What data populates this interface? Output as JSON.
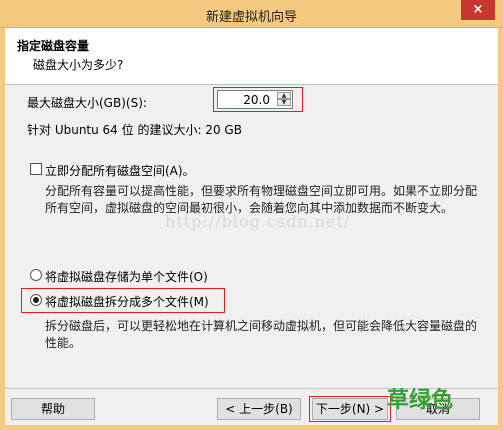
{
  "window": {
    "title": "新建虚拟机向导",
    "close": "×"
  },
  "header": {
    "title": "指定磁盘容量",
    "subtitle": "磁盘大小为多少?"
  },
  "disk": {
    "max_label": "最大磁盘大小(GB)(S):",
    "max_value": "20.0",
    "recommend": "针对 Ubuntu 64 位 的建议大小: 20 GB"
  },
  "allocate": {
    "label": "立即分配所有磁盘空间(A)。",
    "desc": "分配所有容量可以提高性能，但要求所有物理磁盘空间立即可用。如果不立即分配所有空间，虚拟磁盘的空间最初很小，会随着您向其中添加数据而不断变大。",
    "checked": false
  },
  "watermark": "http://blog.csdn.net/",
  "options": {
    "single": "将虚拟磁盘存储为单个文件(O)",
    "multiple": "将虚拟磁盘拆分成多个文件(M)",
    "selected": "multiple",
    "multiple_desc": "拆分磁盘后，可以更轻松地在计算机之间移动虚拟机，但可能会降低大容量磁盘的性能。"
  },
  "footer": {
    "help": "帮助",
    "back": "< 上一步(B)",
    "next": "下一步(N) >",
    "cancel": "取消",
    "overlay_text": "草绿色"
  },
  "colors": {
    "titlebar": "#f6c980",
    "highlight": "#e02020",
    "overlay": "#34a12e"
  }
}
